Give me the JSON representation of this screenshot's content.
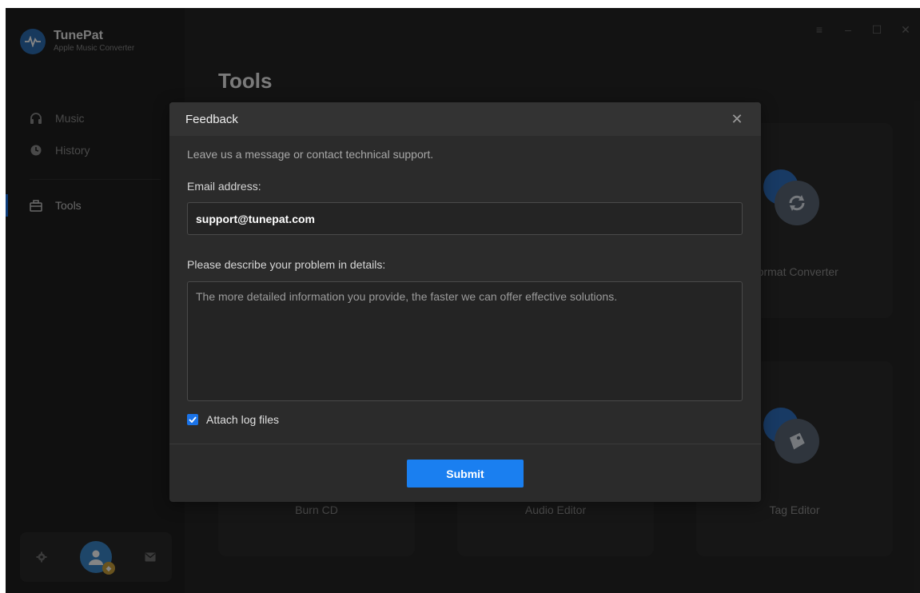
{
  "app": {
    "name": "TunePat",
    "subtitle": "Apple Music Converter"
  },
  "sidebar": {
    "items": [
      {
        "label": "Music",
        "icon": "headphones-icon"
      },
      {
        "label": "History",
        "icon": "clock-icon"
      },
      {
        "label": "Tools",
        "icon": "toolbox-icon",
        "active": true
      }
    ]
  },
  "main": {
    "title": "Tools",
    "tools": [
      {
        "label": "Format Converter",
        "icon": "refresh-icon"
      },
      {
        "label": "Burn CD",
        "icon": "cd-icon"
      },
      {
        "label": "Audio Editor",
        "icon": "audio-icon"
      },
      {
        "label": "Tag Editor",
        "icon": "tag-icon"
      }
    ]
  },
  "window_controls": [
    "menu-icon",
    "minimize-icon",
    "maximize-icon",
    "close-icon"
  ],
  "feedback": {
    "title": "Feedback",
    "intro": "Leave us a message or contact technical support.",
    "email_label": "Email address:",
    "email_value": "support@tunepat.com",
    "problem_label": "Please describe your problem in details:",
    "problem_placeholder": "The more detailed information you provide, the faster we can offer effective solutions.",
    "attach_label": "Attach log files",
    "attach_checked": true,
    "submit_label": "Submit"
  },
  "colors": {
    "accent": "#1a7ff0",
    "background": "#262626",
    "sidebar": "#1f1f1f"
  }
}
